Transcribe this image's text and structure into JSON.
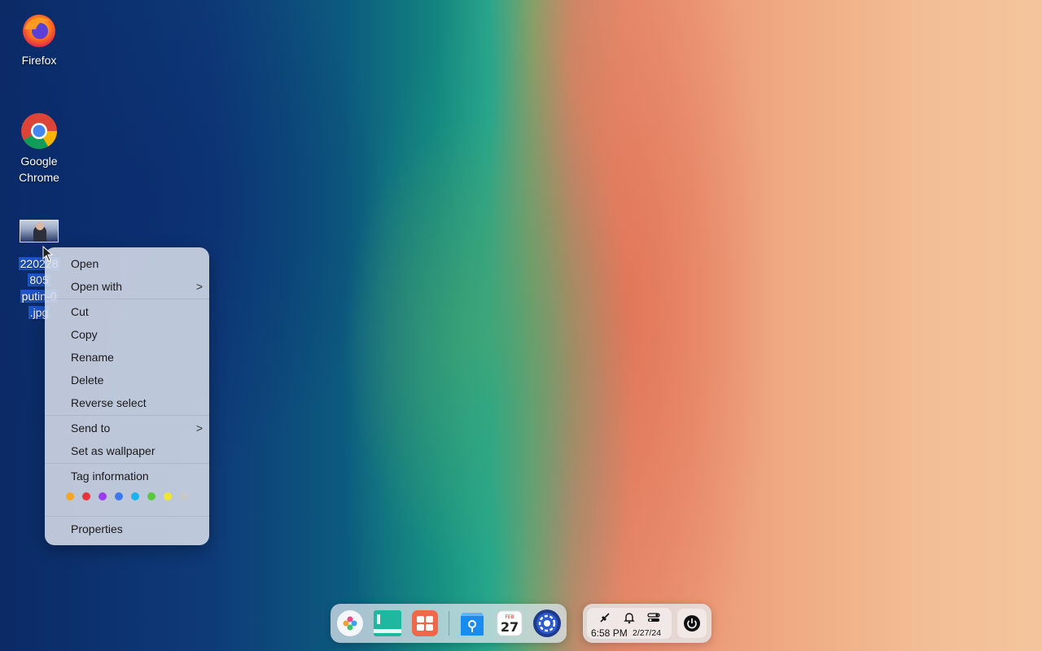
{
  "desktop": {
    "icons": [
      {
        "label": "Firefox"
      },
      {
        "label": "Google Chrome"
      }
    ],
    "selected_file": {
      "label_lines": [
        "220228",
        "805",
        "putin-0",
        ".jpg"
      ]
    }
  },
  "context_menu": {
    "open": "Open",
    "open_with": "Open with",
    "cut": "Cut",
    "copy": "Copy",
    "rename": "Rename",
    "delete": "Delete",
    "reverse_select": "Reverse select",
    "send_to": "Send to",
    "set_as_wallpaper": "Set as wallpaper",
    "tag_information": "Tag information",
    "properties": "Properties",
    "submenu_arrow": ">",
    "tag_colors": [
      "#f5a623",
      "#e8323c",
      "#9b3cf0",
      "#3c78f0",
      "#19b4f0",
      "#5ac83c",
      "#f0e632",
      "#c8c8c8"
    ]
  },
  "dock": {
    "apps": [
      "launcher-icon",
      "file-manager-icon",
      "app-store-icon",
      "deepin-store-icon",
      "calendar-icon",
      "settings-icon"
    ],
    "calendar_day": "27",
    "calendar_month": "FEB"
  },
  "tray": {
    "time": "6:58 PM",
    "date": "2/27/24"
  }
}
